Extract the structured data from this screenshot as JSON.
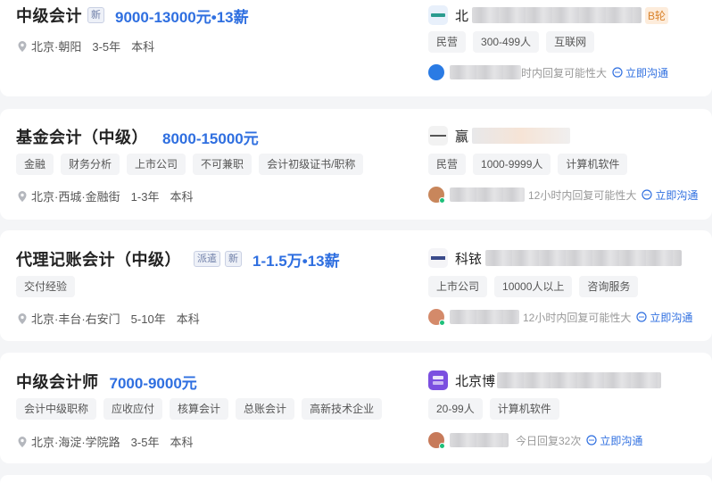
{
  "jobs": [
    {
      "title": "中级会计",
      "badges": [
        "新"
      ],
      "salary": "9000-13000元•13薪",
      "skill_tags": [],
      "location": "北京·朝阳",
      "experience": "3-5年",
      "education": "本科",
      "company": {
        "name_visible": "北",
        "round_badge": "B轮",
        "tags": [
          "民营",
          "300-499人",
          "互联网"
        ],
        "logo_color": "#e8f0fb"
      },
      "recruiter": {
        "name_visible": "",
        "reply_text": "时内回复可能性大",
        "avatar_color": "#2a7be4"
      },
      "chat_label": "立即沟通"
    },
    {
      "title": "基金会计（中级）",
      "badges": [],
      "salary": "8000-15000元",
      "skill_tags": [
        "金融",
        "财务分析",
        "上市公司",
        "不可兼职",
        "会计初级证书/职称"
      ],
      "location": "北京·西城·金融街",
      "experience": "1-3年",
      "education": "本科",
      "company": {
        "name_visible": "赢",
        "round_badge": "",
        "tags": [
          "民营",
          "1000-9999人",
          "计算机软件"
        ],
        "logo_color": "#f2f2f2"
      },
      "recruiter": {
        "name_visible": "",
        "reply_text": "12小时内回复可能性大",
        "avatar_color": "#c8865b"
      },
      "chat_label": "立即沟通"
    },
    {
      "title": "代理记账会计（中级）",
      "badges": [
        "派遣",
        "新"
      ],
      "salary": "1-1.5万•13薪",
      "skill_tags": [
        "交付经验"
      ],
      "location": "北京·丰台·右安门",
      "experience": "5-10年",
      "education": "本科",
      "company": {
        "name_visible": "科铱",
        "round_badge": "",
        "tags": [
          "上市公司",
          "10000人以上",
          "咨询服务"
        ],
        "logo_color": "#f4f4f7"
      },
      "recruiter": {
        "name_visible": "",
        "reply_text": "12小时内回复可能性大",
        "avatar_color": "#d48a6a"
      },
      "chat_label": "立即沟通"
    },
    {
      "title": "中级会计师",
      "badges": [],
      "salary": "7000-9000元",
      "skill_tags": [
        "会计中级职称",
        "应收应付",
        "核算会计",
        "总账会计",
        "高新技术企业"
      ],
      "location": "北京·海淀·学院路",
      "experience": "3-5年",
      "education": "本科",
      "company": {
        "name_visible": "北京博",
        "round_badge": "",
        "tags": [
          "20-99人",
          "计算机软件"
        ],
        "logo_color": "#7b4fe0"
      },
      "recruiter": {
        "name_visible": "",
        "reply_text": "今日回复32次",
        "avatar_color": "#c77a5a"
      },
      "chat_label": "立即沟通"
    }
  ]
}
